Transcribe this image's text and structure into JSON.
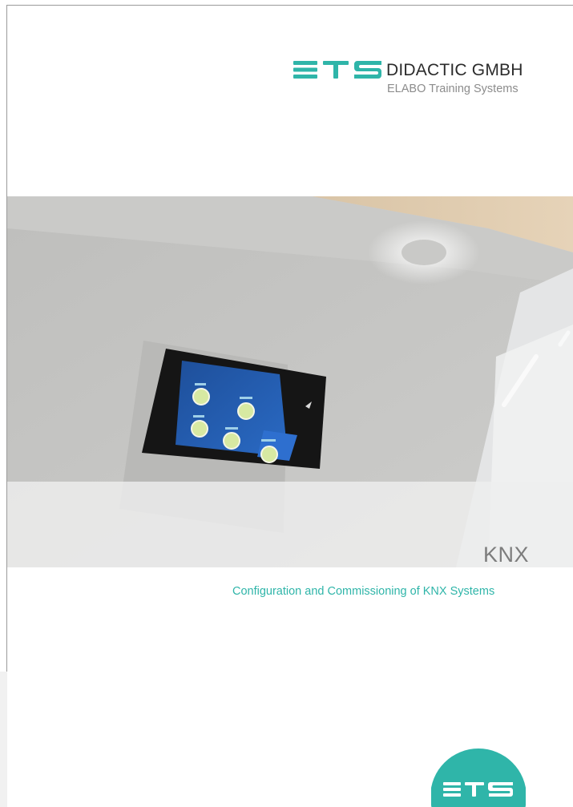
{
  "brand": {
    "company": "DIDACTIC GMBH",
    "subline": "ELABO Training Systems",
    "logo_mark": "ETS",
    "accent_color": "#2fb5a9"
  },
  "photo": {
    "caption": "KNX"
  },
  "tagline": "Configuration and Commissioning of KNX Systems"
}
